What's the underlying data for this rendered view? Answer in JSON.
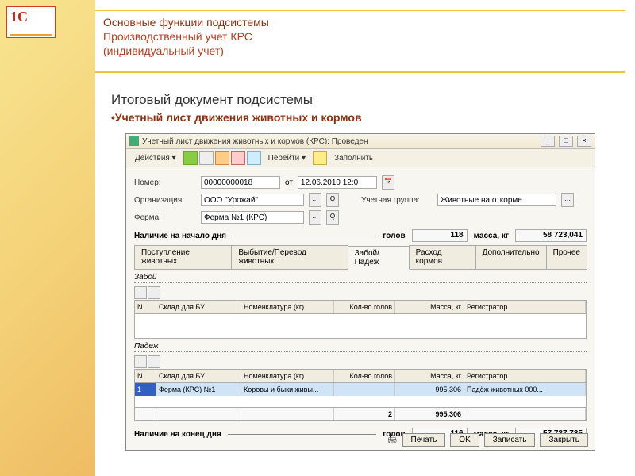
{
  "slide": {
    "title1": "Основные функции подсистемы",
    "title2": "Производственный учет КРС",
    "title3": "(индивидуальный учет)",
    "subtitle1": "Итоговый документ подсистемы",
    "subtitle2": "Учетный лист движения животных и кормов"
  },
  "window": {
    "title": "Учетный лист движения животных и кормов (КРС): Проведен",
    "toolbar": {
      "actions": "Действия ▾",
      "goto": "Перейти ▾",
      "fill": "Заполнить"
    },
    "fields": {
      "number_label": "Номер:",
      "number": "00000000018",
      "date_label": "от",
      "date": "12.06.2010 12:0",
      "org_label": "Организация:",
      "org": "ООО \"Урожай\"",
      "group_label": "Учетная группа:",
      "group": "Животные на откорме",
      "farm_label": "Ферма:",
      "farm": "Ферма №1 (КРС)"
    },
    "start": {
      "title": "Наличие на начало дня",
      "heads_label": "голов",
      "heads": "118",
      "mass_label": "масса, кг",
      "mass": "58 723,041"
    },
    "tabs": [
      "Поступление животных",
      "Выбытие/Перевод животных",
      "Забой/Падеж",
      "Расход кормов",
      "Дополнительно",
      "Прочее"
    ],
    "active_tab": 2,
    "zaboy": {
      "title": "Забой",
      "columns": [
        "N",
        "Склад для БУ",
        "Номенклатура (кг)",
        "Кол-во голов",
        "Масса, кг",
        "Регистратор"
      ]
    },
    "padezh": {
      "title": "Падеж",
      "columns": [
        "N",
        "Склад для БУ",
        "Номенклатура (кг)",
        "Кол-во голов",
        "Масса, кг",
        "Регистратор"
      ],
      "rows": [
        {
          "n": "1",
          "sklad": "Ферма (КРС) №1",
          "nomen": "Коровы и быки живы...",
          "golov": "",
          "massa": "995,306",
          "reg": "Падёж животных 000..."
        }
      ],
      "total_golov": "2",
      "total_massa": "995,306"
    },
    "end": {
      "title": "Наличие на конец дня",
      "heads_label": "голов",
      "heads": "116",
      "mass_label": "масса, кг",
      "mass": "57 727,735"
    },
    "buttons": {
      "print": "Печать",
      "ok": "OK",
      "save": "Записать",
      "close": "Закрыть"
    }
  }
}
